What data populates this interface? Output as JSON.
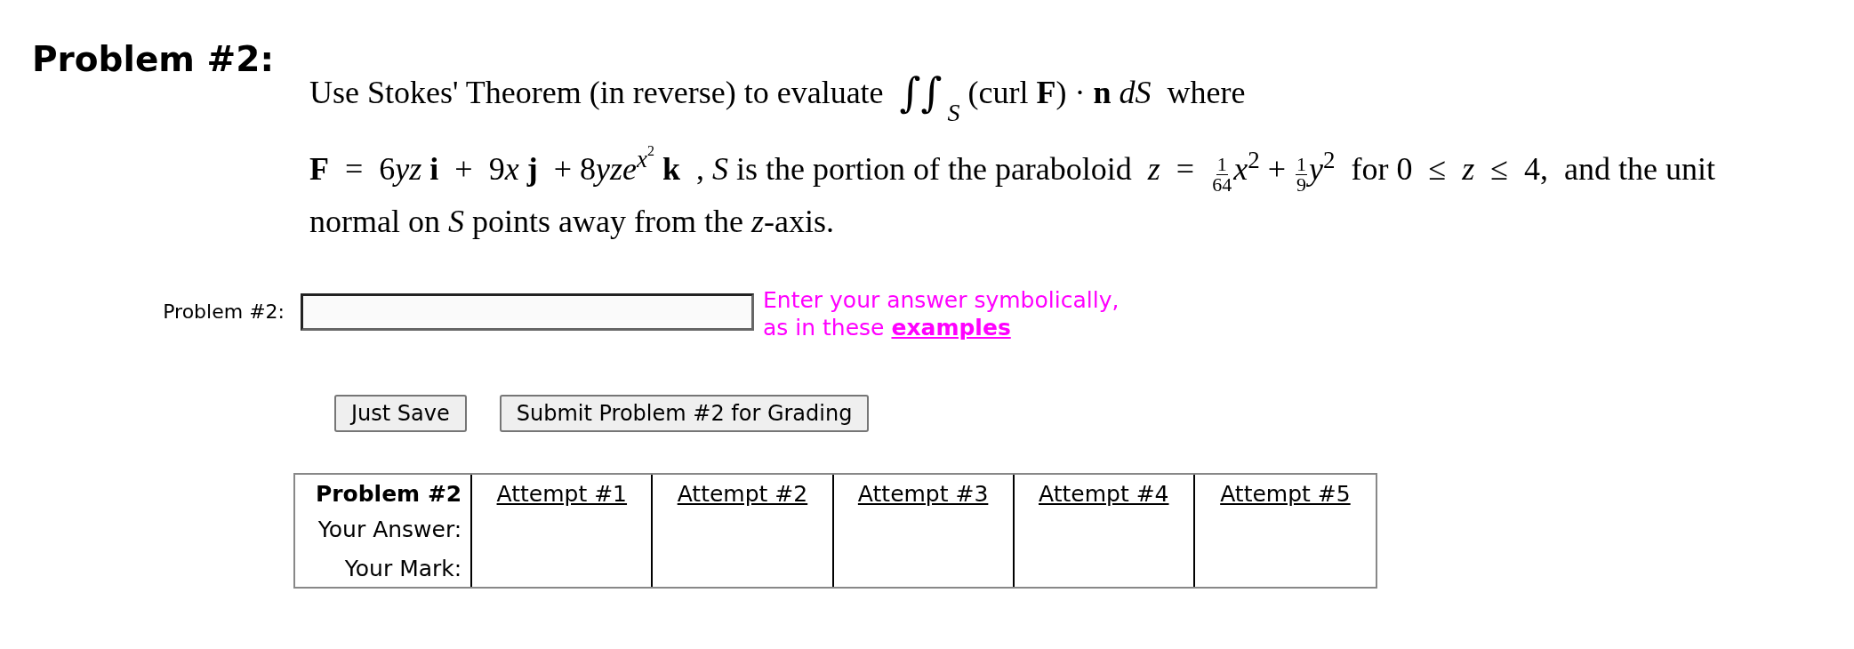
{
  "heading": "Problem #2:",
  "statement": [
    [
      {
        "kind": "text",
        "text": "Use Stokes' Theorem (in reverse) to evaluate  "
      },
      {
        "kind": "integral",
        "symbol": "∫∫",
        "sub": "*S*"
      },
      {
        "kind": "text",
        "text": " (curl **F**) · **n** *dS*  where"
      }
    ],
    [
      {
        "kind": "text",
        "text": "**F**  =  6"
      },
      {
        "kind": "text",
        "text": "*yz* **i**  +  9"
      },
      {
        "kind": "text",
        "text": "*x* **j**  + 8"
      },
      {
        "kind": "text",
        "text": "*yze*"
      },
      {
        "kind": "power",
        "text": "$^{x}$$^{2}$"
      },
      {
        "kind": "text",
        "text": " **k**  , *S* is the portion of the paraboloid  *z*  =  "
      },
      {
        "kind": "fraction",
        "num": "1",
        "den": "64"
      },
      {
        "kind": "text",
        "text": "*x*$^{2}$ + "
      },
      {
        "kind": "fraction",
        "num": "1",
        "den": "9"
      },
      {
        "kind": "text",
        "text": "*y*$^{2}$  for 0  ≤  *z*  ≤  4,  and the unit"
      }
    ],
    [
      {
        "kind": "text",
        "text": "normal on *S* points away from the *z*-axis."
      }
    ]
  ],
  "answer": {
    "label": "Problem #2:",
    "hint": "Enter your answer symbolically,",
    "hint2": "as in these",
    "link": "examples"
  },
  "buttons": [
    "Just Save",
    "Submit Problem #2 for Grading"
  ],
  "table": {
    "header": "Problem #2",
    "row_labels": [
      "Your Answer:",
      "Your Mark:"
    ],
    "attempts": [
      "Attempt #1",
      "Attempt #2",
      "Attempt #3",
      "Attempt #4",
      "Attempt #5"
    ]
  }
}
